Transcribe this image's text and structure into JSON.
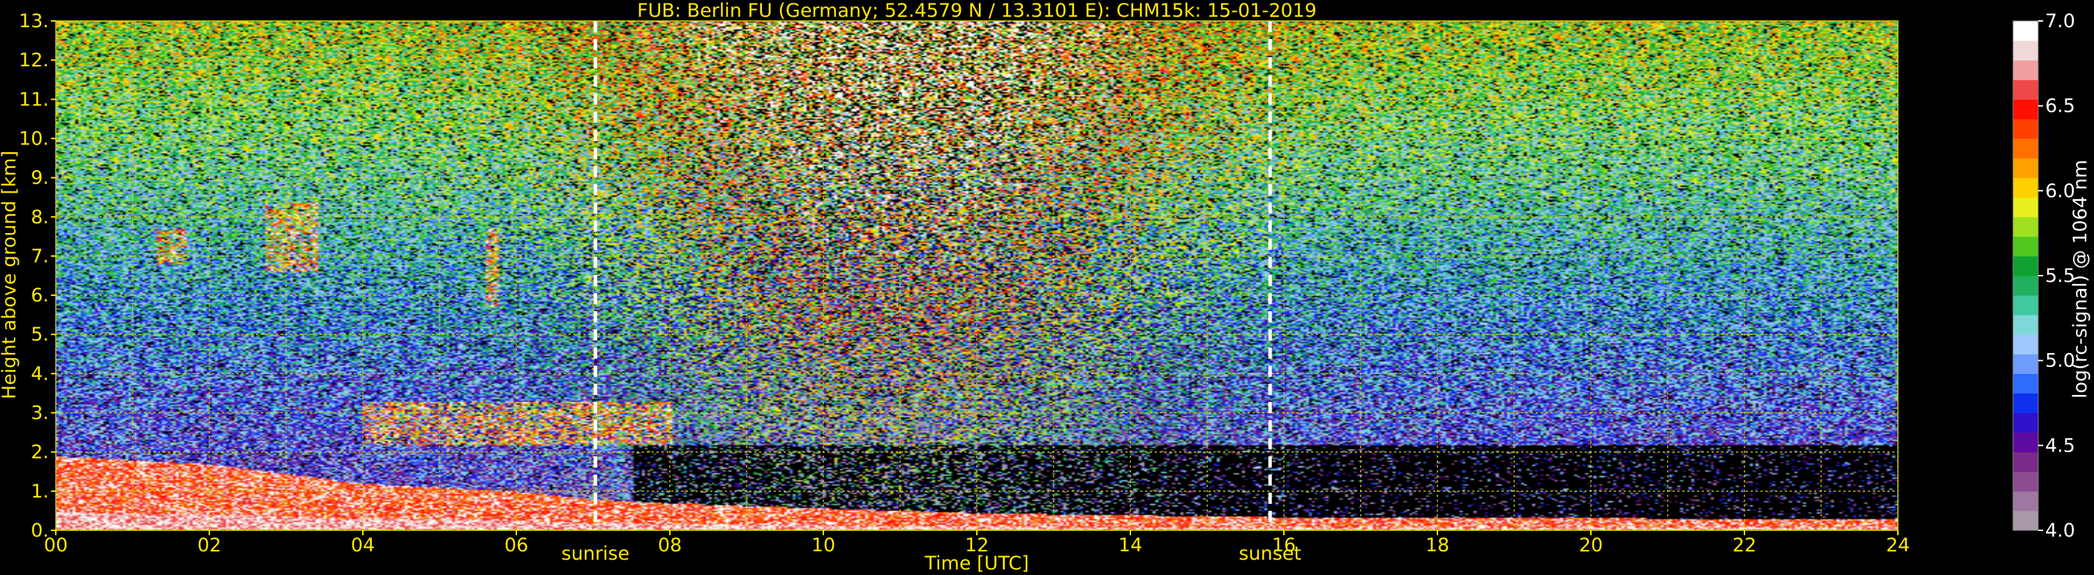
{
  "chart_data": {
    "type": "heatmap",
    "title": "FUB: Berlin FU (Germany; 52.4579 N / 13.3101 E):    CHM15k: 15-01-2019",
    "xlabel": "Time [UTC]",
    "ylabel": "Height above ground [km]",
    "xlim": [
      0,
      24
    ],
    "ylim": [
      0,
      13
    ],
    "x_ticks": [
      "00",
      "02",
      "04",
      "06",
      "08",
      "10",
      "12",
      "14",
      "16",
      "18",
      "20",
      "22",
      "24"
    ],
    "y_ticks": [
      "0.",
      "1.",
      "2.",
      "3.",
      "4.",
      "5.",
      "6.",
      "7.",
      "8.",
      "9.",
      "10.",
      "11.",
      "12.",
      "13."
    ],
    "grid": true,
    "colorbar": {
      "label": "log(rc-signal) @ 1064 nm",
      "range": [
        4.0,
        7.0
      ],
      "ticks": [
        "4.0",
        "4.5",
        "5.0",
        "5.5",
        "6.0",
        "6.5",
        "7.0"
      ],
      "colors": [
        "#a89aa8",
        "#9e78a0",
        "#8c4c90",
        "#7a2a88",
        "#5e0aa0",
        "#3010c8",
        "#1030f0",
        "#2d6cff",
        "#6f9cff",
        "#a0c8ff",
        "#7fd8d8",
        "#40c8a0",
        "#20b060",
        "#10a030",
        "#50c820",
        "#a0e020",
        "#e8f020",
        "#ffd000",
        "#ffa000",
        "#ff7000",
        "#ff4000",
        "#ff1000",
        "#f04848",
        "#f0a0a0",
        "#f0d8d8",
        "#ffffff"
      ]
    },
    "annotations": [
      {
        "text": "sunrise",
        "x": 7.03
      },
      {
        "text": "sunset",
        "x": 15.82
      }
    ],
    "features": {
      "boundary_layer_top_km": [
        [
          0,
          1.9
        ],
        [
          2,
          1.7
        ],
        [
          4,
          1.2
        ],
        [
          6,
          1.0
        ],
        [
          7,
          0.8
        ],
        [
          8,
          0.7
        ],
        [
          12,
          0.45
        ],
        [
          16,
          0.35
        ],
        [
          24,
          0.3
        ]
      ],
      "cloud_layers": [
        {
          "x": [
            1.3,
            1.7
          ],
          "y": [
            6.8,
            7.7
          ]
        },
        {
          "x": [
            2.7,
            3.4
          ],
          "y": [
            6.6,
            8.4
          ]
        },
        {
          "x": [
            5.6,
            5.75
          ],
          "y": [
            5.7,
            7.7
          ]
        },
        {
          "x": [
            4.0,
            8.0
          ],
          "y": [
            2.2,
            3.3
          ]
        }
      ],
      "noise_peak_hour": 11
    }
  }
}
